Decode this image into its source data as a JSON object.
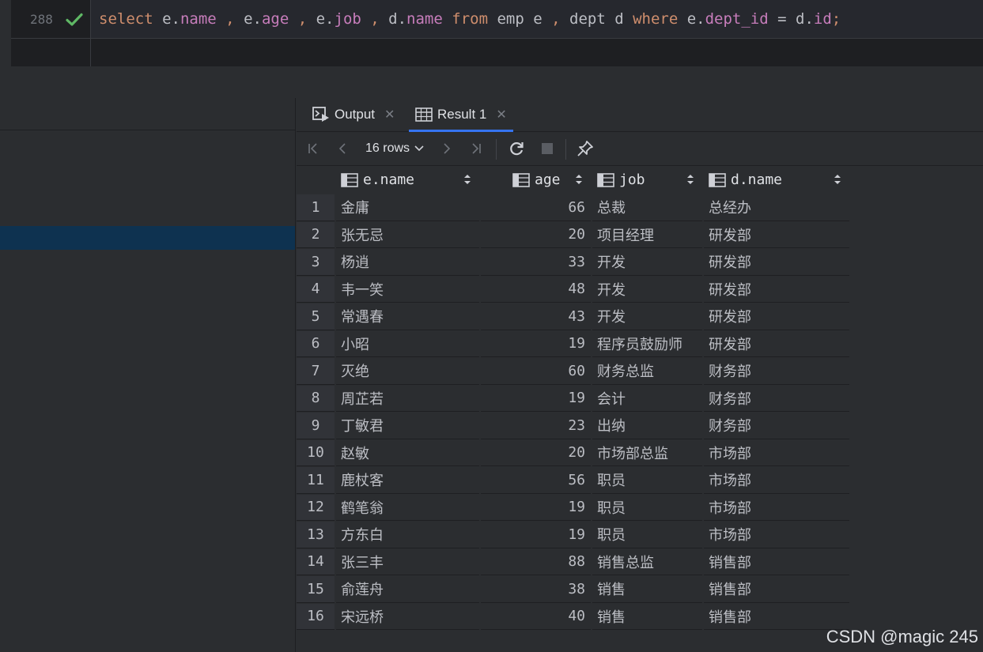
{
  "editor": {
    "line_number": "288",
    "tokens": [
      {
        "t": "select",
        "c": "kw"
      },
      {
        "t": " e.",
        "c": "id"
      },
      {
        "t": "name",
        "c": "field"
      },
      {
        "t": " , ",
        "c": "kw"
      },
      {
        "t": "e.",
        "c": "id"
      },
      {
        "t": "age",
        "c": "field"
      },
      {
        "t": " , ",
        "c": "kw"
      },
      {
        "t": "e.",
        "c": "id"
      },
      {
        "t": "job",
        "c": "field"
      },
      {
        "t": " , ",
        "c": "kw"
      },
      {
        "t": "d.",
        "c": "id"
      },
      {
        "t": "name",
        "c": "field"
      },
      {
        "t": " ",
        "c": "id"
      },
      {
        "t": "from",
        "c": "kw"
      },
      {
        "t": " emp e ",
        "c": "id"
      },
      {
        "t": ",",
        "c": "kw"
      },
      {
        "t": " dept d ",
        "c": "id"
      },
      {
        "t": "where",
        "c": "kw"
      },
      {
        "t": " e.",
        "c": "id"
      },
      {
        "t": "dept_id",
        "c": "field"
      },
      {
        "t": " = d.",
        "c": "id"
      },
      {
        "t": "id",
        "c": "field"
      },
      {
        "t": ";",
        "c": "kw"
      }
    ],
    "status_icon": "check-icon",
    "status_color": "#5fb865"
  },
  "tabs": [
    {
      "label": "Output",
      "icon": "output-console-icon",
      "active": false
    },
    {
      "label": "Result 1",
      "icon": "table-icon",
      "active": true
    }
  ],
  "toolbar": {
    "rows_label": "16 rows",
    "buttons": [
      "first-page-icon",
      "prev-page-icon",
      "next-page-icon",
      "last-page-icon",
      "refresh-icon",
      "stop-icon",
      "pin-icon"
    ]
  },
  "grid": {
    "columns": [
      {
        "label": "e.name"
      },
      {
        "label": "age"
      },
      {
        "label": "job"
      },
      {
        "label": "d.name"
      }
    ],
    "rows": [
      [
        "1",
        "金庸",
        "66",
        "总裁",
        "总经办"
      ],
      [
        "2",
        "张无忌",
        "20",
        "项目经理",
        "研发部"
      ],
      [
        "3",
        "杨逍",
        "33",
        "开发",
        "研发部"
      ],
      [
        "4",
        "韦一笑",
        "48",
        "开发",
        "研发部"
      ],
      [
        "5",
        "常遇春",
        "43",
        "开发",
        "研发部"
      ],
      [
        "6",
        "小昭",
        "19",
        "程序员鼓励师",
        "研发部"
      ],
      [
        "7",
        "灭绝",
        "60",
        "财务总监",
        "财务部"
      ],
      [
        "8",
        "周芷若",
        "19",
        "会计",
        "财务部"
      ],
      [
        "9",
        "丁敏君",
        "23",
        "出纳",
        "财务部"
      ],
      [
        "10",
        "赵敏",
        "20",
        "市场部总监",
        "市场部"
      ],
      [
        "11",
        "鹿杖客",
        "56",
        "职员",
        "市场部"
      ],
      [
        "12",
        "鹤笔翁",
        "19",
        "职员",
        "市场部"
      ],
      [
        "13",
        "方东白",
        "19",
        "职员",
        "市场部"
      ],
      [
        "14",
        "张三丰",
        "88",
        "销售总监",
        "销售部"
      ],
      [
        "15",
        "俞莲舟",
        "38",
        "销售",
        "销售部"
      ],
      [
        "16",
        "宋远桥",
        "40",
        "销售",
        "销售部"
      ]
    ]
  },
  "watermark": "CSDN @magic 245",
  "colors": {
    "accent": "#3574f0",
    "keyword": "#cf8e6d",
    "field": "#c77dbb",
    "selection": "#0e3250"
  }
}
